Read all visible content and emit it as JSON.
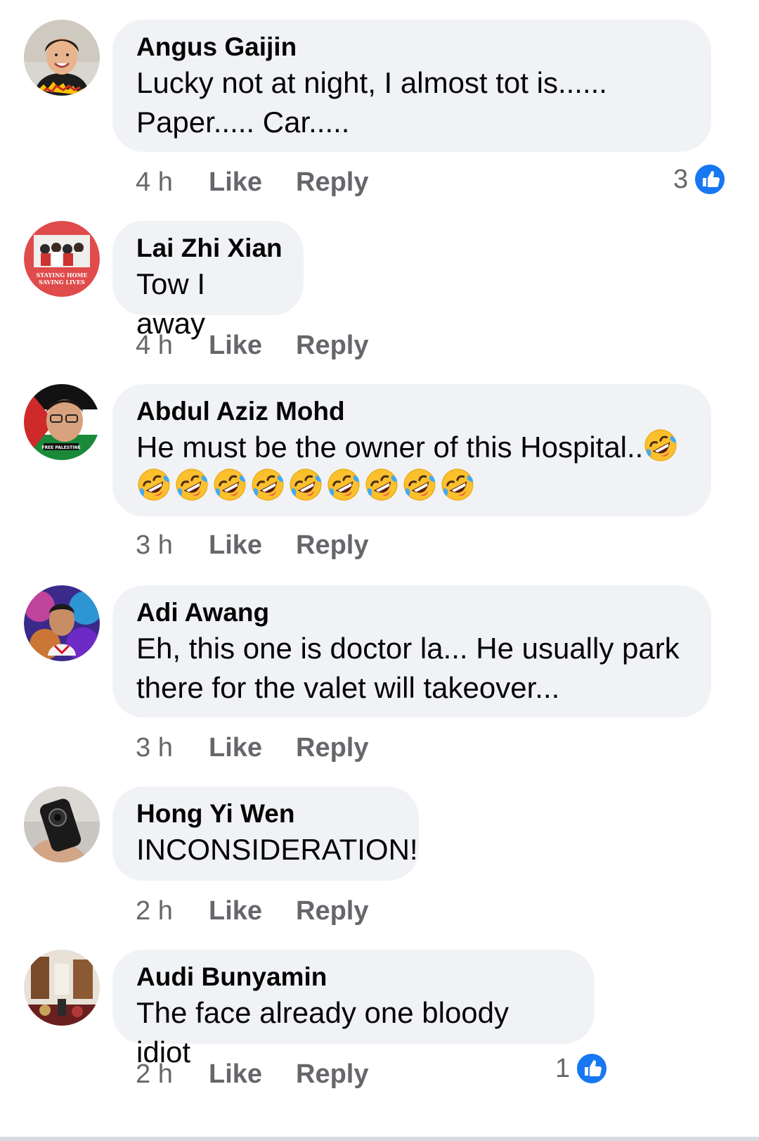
{
  "comments": [
    {
      "author": "Angus Gaijin",
      "lines": [
        "Lucky not at night, I almost tot is......",
        "Paper..... Car....."
      ],
      "time": "4 h",
      "like_label": "Like",
      "reply_label": "Reply",
      "reaction_count": "3"
    },
    {
      "author": "Lai Zhi Xian",
      "lines": [
        "Tow I away"
      ],
      "time": "4 h",
      "like_label": "Like",
      "reply_label": "Reply",
      "avatar_text": [
        "STAYING HOME",
        "SAVING LIVES"
      ]
    },
    {
      "author": "Abdul Aziz Mohd",
      "lines": [
        "He must be the owner of this Hospital.."
      ],
      "emoji_count_line1": 1,
      "emoji_count_line2": 9,
      "time": "3 h",
      "like_label": "Like",
      "reply_label": "Reply",
      "avatar_text": "FREE PALESTINE"
    },
    {
      "author": "Adi Awang",
      "lines": [
        "Eh, this one is doctor la... He usually park",
        "there for the valet will takeover..."
      ],
      "time": "3 h",
      "like_label": "Like",
      "reply_label": "Reply"
    },
    {
      "author": "Hong Yi Wen",
      "lines": [
        "INCONSIDERATION!"
      ],
      "time": "2 h",
      "like_label": "Like",
      "reply_label": "Reply"
    },
    {
      "author": "Audi Bunyamin",
      "lines": [
        "The face already one bloody idiot"
      ],
      "time": "2 h",
      "like_label": "Like",
      "reply_label": "Reply",
      "reaction_count": "1"
    }
  ],
  "icons": {
    "reaction": "like-reaction-icon",
    "emoji": "rolling-on-floor-laughing-emoji"
  },
  "colors": {
    "bubble": "#f0f2f5",
    "meta_text": "#65676b",
    "like_blue": "#1877f2"
  }
}
